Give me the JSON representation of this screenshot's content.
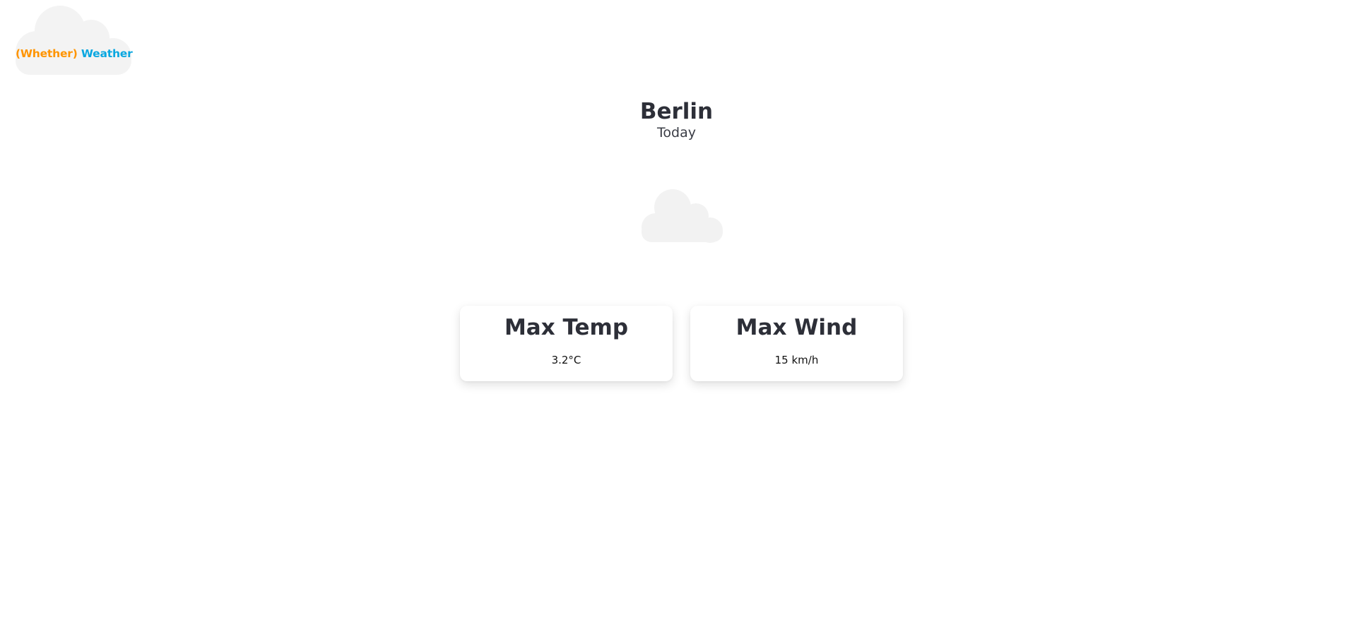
{
  "logo": {
    "icon": "cloud-icon",
    "word_1": "(Whether)",
    "word_2": "Weather",
    "color_1": "#ff9400",
    "color_2": "#0aa7e0"
  },
  "location": {
    "city": "Berlin",
    "day": "Today"
  },
  "weather": {
    "icon": "cloud-icon",
    "icon_color": "#f2f2f2"
  },
  "cards": [
    {
      "title": "Max Temp",
      "value": "3.2°C"
    },
    {
      "title": "Max Wind",
      "value": "15 km/h"
    }
  ]
}
